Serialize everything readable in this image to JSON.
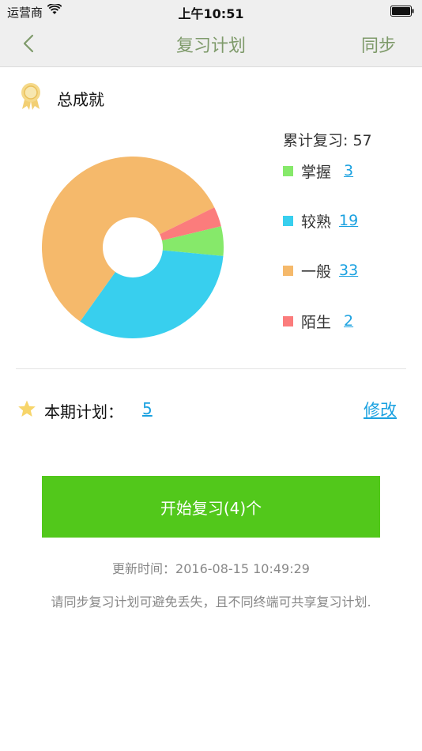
{
  "status_bar": {
    "carrier": "运营商",
    "time": "上午10:51"
  },
  "nav": {
    "title": "复习计划",
    "sync_label": "同步"
  },
  "achievement": {
    "title": "总成就",
    "total_label": "累计复习: 57"
  },
  "legend": [
    {
      "label": "掌握",
      "value": "3",
      "color": "#86e96a"
    },
    {
      "label": "较熟",
      "value": "19",
      "color": "#38cfee"
    },
    {
      "label": "一般",
      "value": "33",
      "color": "#f5b96b"
    },
    {
      "label": "陌生",
      "value": "2",
      "color": "#fb7c7c"
    }
  ],
  "chart_data": {
    "type": "pie",
    "categories": [
      "掌握",
      "较熟",
      "一般",
      "陌生"
    ],
    "values": [
      3,
      19,
      33,
      2
    ],
    "colors": [
      "#86e96a",
      "#38cfee",
      "#f5b96b",
      "#fb7c7c"
    ],
    "title": "",
    "donut": true
  },
  "plan": {
    "label": "本期计划：",
    "value": "5",
    "edit_label": "修改"
  },
  "start_button": {
    "label": "开始复习(4)个"
  },
  "footer": {
    "update_time": "更新时间：2016-08-15 10:49:29",
    "notice": "请同步复习计划可避免丢失，且不同终端可共享复习计划."
  }
}
